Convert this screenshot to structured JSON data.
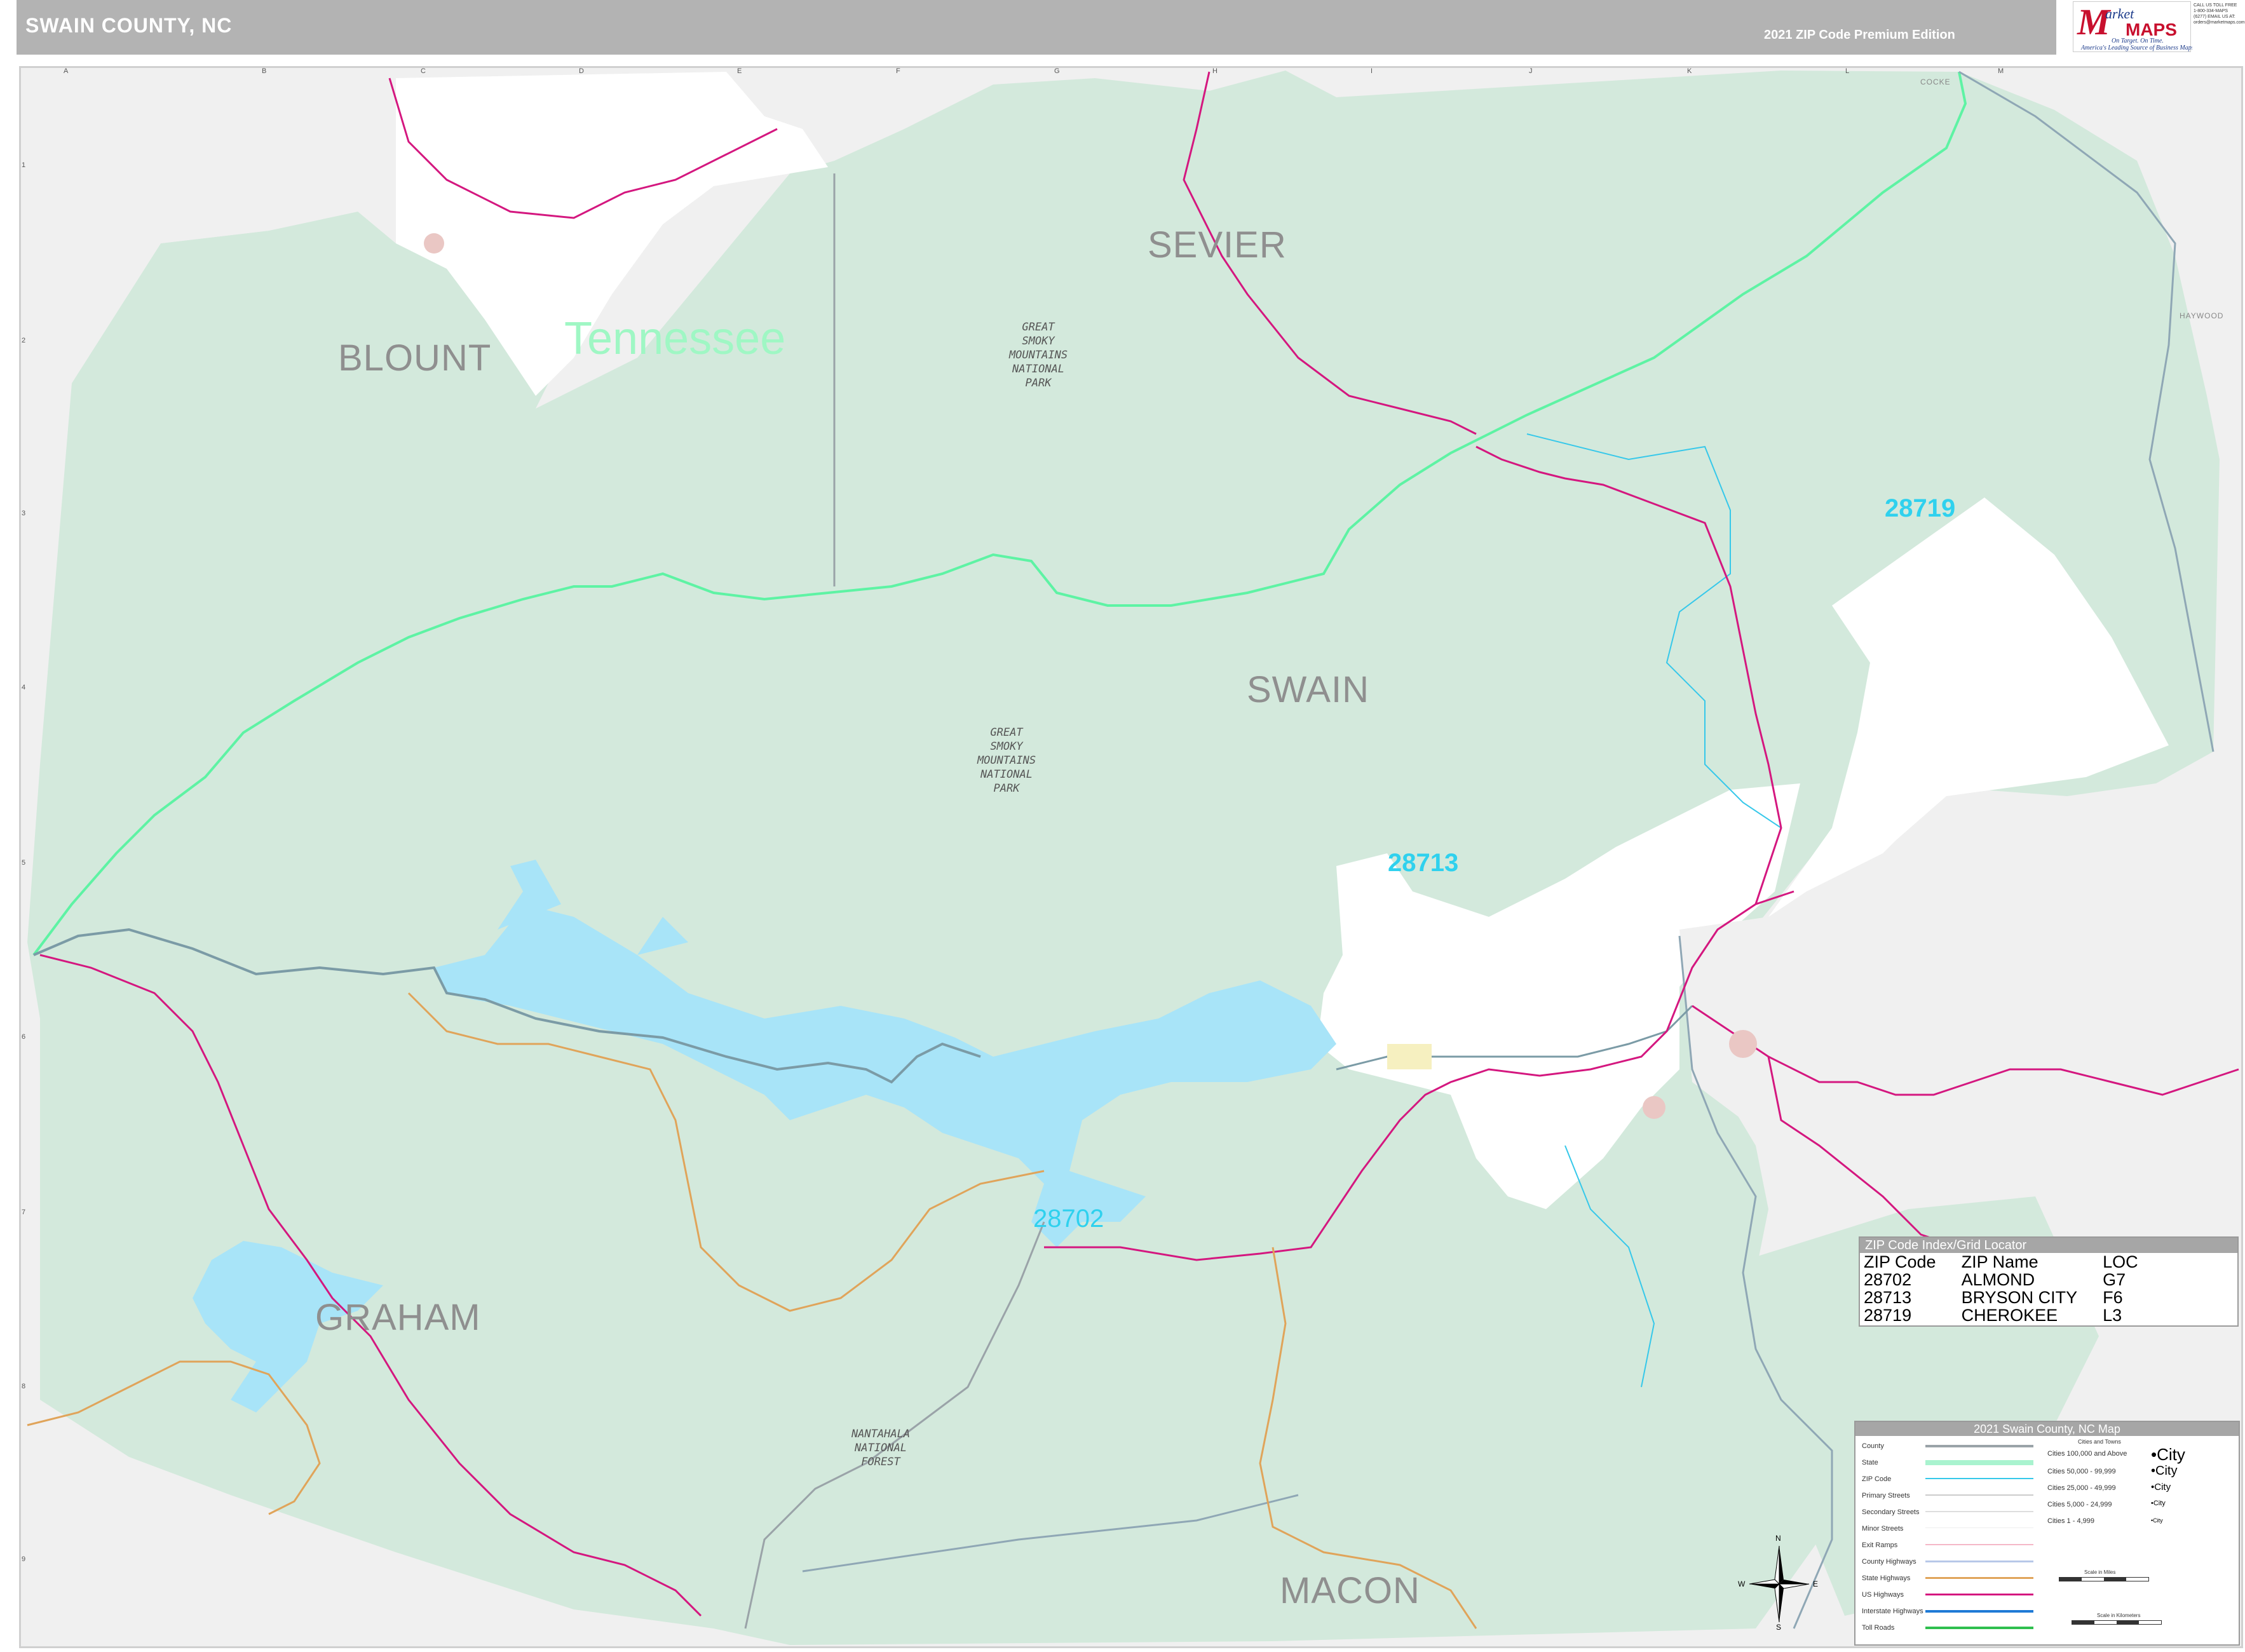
{
  "header": {
    "title": "SWAIN COUNTY, NC",
    "edition": "2021 ZIP Code Premium Edition"
  },
  "logo": {
    "letter": "M",
    "word1": "arket",
    "word2": "MAPS",
    "tagline1": "On Target. On Time.",
    "tagline2": "America's Leading Source of Business Maps",
    "contact": "CALL US TOLL FREE 1-800-334-MAPS (6277) EMAIL US AT: orders@marketmaps.com"
  },
  "grid": {
    "columns": [
      "A",
      "B",
      "C",
      "D",
      "E",
      "F",
      "G",
      "H",
      "I",
      "J",
      "K",
      "L",
      "M"
    ],
    "rows": [
      "1",
      "2",
      "3",
      "4",
      "5",
      "6",
      "7",
      "8",
      "9"
    ]
  },
  "counties": {
    "blount": "BLOUNT",
    "sevier": "SEVIER",
    "swain": "SWAIN",
    "graham": "GRAHAM",
    "macon": "MACON",
    "cocke": "COCKE",
    "haywood": "HAYWOOD"
  },
  "state_label": "Tennessee",
  "park_labels": {
    "gsmnp_tn": "GREAT\nSMOKY\nMOUNTAINS\nNATIONAL\nPARK",
    "gsmnp_nc": "GREAT\nSMOKY\nMOUNTAINS\nNATIONAL\nPARK",
    "nantahala": "NANTAHALA\nNATIONAL\nFOREST"
  },
  "zip_labels": {
    "z28719": "28719",
    "z28713": "28713",
    "z28702": "28702"
  },
  "zip_index": {
    "title": "ZIP Code Index/Grid Locator",
    "headers": [
      "ZIP Code",
      "ZIP Name",
      "LOC"
    ],
    "rows": [
      [
        "28702",
        "ALMOND",
        "G7"
      ],
      [
        "28713",
        "BRYSON CITY",
        "F6"
      ],
      [
        "28719",
        "CHEROKEE",
        "L3"
      ]
    ]
  },
  "legend": {
    "title": "2021 Swain County, NC Map",
    "items": [
      "County",
      "State",
      "ZIP Code",
      "Primary Streets",
      "Secondary Streets",
      "Minor Streets",
      "Exit Ramps",
      "County Highways",
      "State Highways",
      "US Highways",
      "Interstate Highways",
      "Toll Roads"
    ],
    "cities_header": "Cities and Towns",
    "cities": [
      [
        "Cities 100,000 and Above",
        "•City"
      ],
      [
        "Cities 50,000 - 99,999",
        "•City"
      ],
      [
        "Cities 25,000 - 49,999",
        "•City"
      ],
      [
        "Cities 5,000 - 24,999",
        "•City"
      ],
      [
        "Cities 1 - 4,999",
        "•City"
      ]
    ],
    "scale_miles": "Scale in Miles",
    "scale_km": "Scale in Kilometers"
  },
  "compass": {
    "n": "N",
    "s": "S",
    "e": "E",
    "w": "W"
  },
  "colors": {
    "park_green": "#d3e9dc",
    "water": "#a8e4f8",
    "state_line": "#5ef3a4",
    "zip_line": "#36c8ea",
    "us_highway": "#d4177f",
    "state_highway": "#e0a45a",
    "county_line": "#9aa3a8",
    "outside": "#f0f0f0"
  }
}
